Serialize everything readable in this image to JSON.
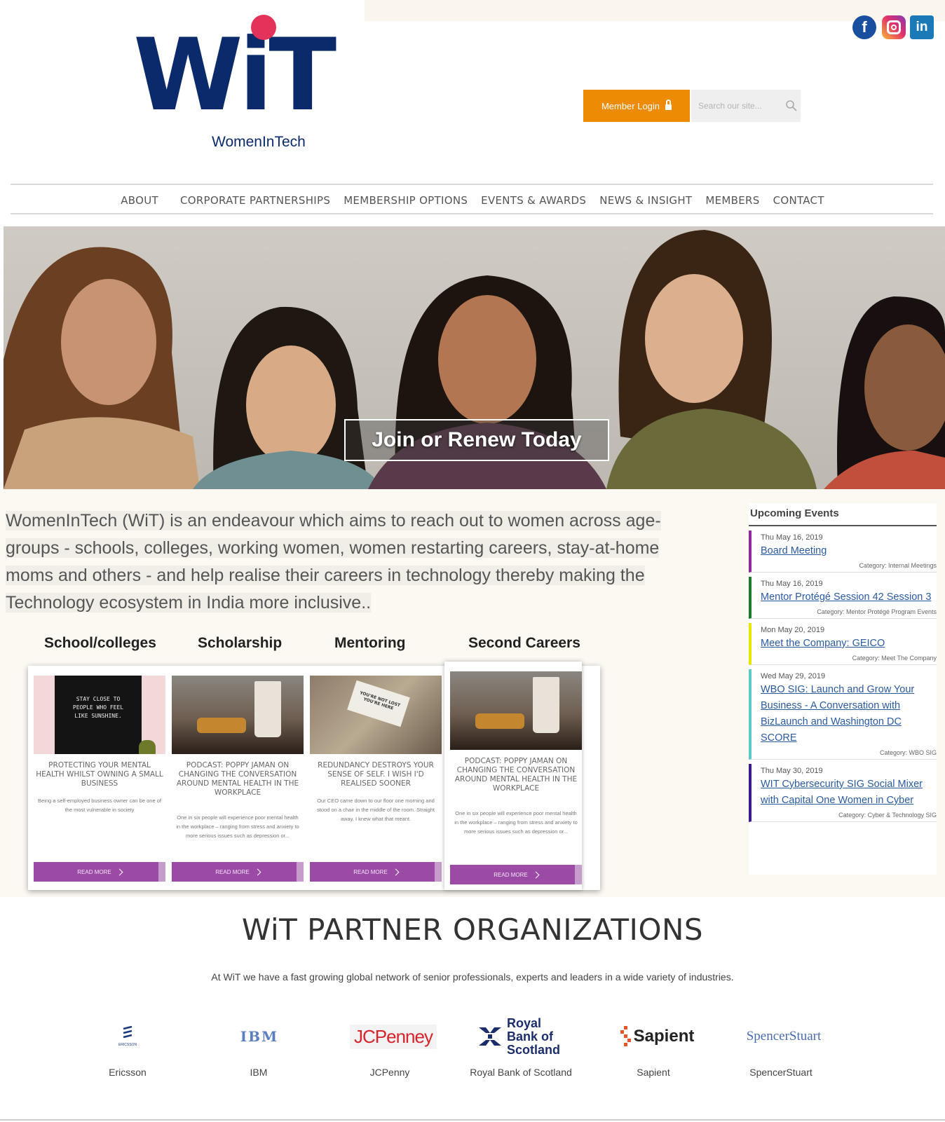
{
  "brand": {
    "logo_word": "WiT",
    "logo_sub": "WomenInTech",
    "colors": {
      "navy": "#0b2a6b",
      "accent_dot": "#e4335a",
      "orange": "#ee8b05",
      "purple": "#9b4aa6"
    }
  },
  "social": [
    {
      "name": "facebook-icon",
      "glyph": "f"
    },
    {
      "name": "instagram-icon",
      "glyph": ""
    },
    {
      "name": "linkedin-icon",
      "glyph": "in"
    }
  ],
  "header": {
    "login_label": "Member Login",
    "search_placeholder": "Search our site..."
  },
  "nav": [
    "ABOUT",
    "CORPORATE PARTNERSHIPS",
    "MEMBERSHIP OPTIONS",
    "EVENTS & AWARDS",
    "NEWS & INSIGHT",
    "MEMBERS",
    "CONTACT"
  ],
  "hero": {
    "cta": "Join or Renew Today"
  },
  "intro": "WomenInTech (WiT) is an endeavour which aims to reach out to women across age-groups - schools, colleges, working women, women restarting careers, stay-at-home moms and others - and help realise their careers in technology thereby making the Technology ecosystem in India more inclusive..",
  "categories": [
    "School/colleges",
    "Scholarship",
    "Mentoring",
    "Second Careers"
  ],
  "cards": [
    {
      "img_text": "STAY CLOSE TO PEOPLE WHO FEEL LIKE SUNSHINE.",
      "title": "PROTECTING YOUR MENTAL HEALTH WHILST OWNING A SMALL BUSINESS",
      "text": "Being a self-employed business owner can be one of the most vulnerable in society",
      "button": "READ MORE"
    },
    {
      "img_text": "",
      "title": "PODCAST: POPPY JAMAN ON CHANGING THE CONVERSATION AROUND MENTAL HEALTH IN THE WORKPLACE",
      "text": "One in six people will experience poor mental health in the workplace – ranging from stress and anxiety to more serious issues such as depression or...",
      "button": "READ MORE"
    },
    {
      "img_text": "YOU'RE NOT LOST YOU'RE HERE",
      "title": "REDUNDANCY DESTROYS YOUR SENSE OF SELF. I WISH I'D REALISED SOONER",
      "text": "Our CEO came down to our floor one morning and stood on a chair in the middle of the room. Straight away, I knew what that meant.",
      "button": "READ MORE"
    },
    {
      "img_text": "",
      "title": "PODCAST: POPPY JAMAN ON CHANGING THE CONVERSATION AROUND MENTAL HEALTH IN THE WORKPLACE",
      "text": "One in six people will experience poor mental health in the workplace – ranging from stress and anxiety to more serious issues such as depression or...",
      "button": "READ MORE"
    }
  ],
  "events": {
    "heading": "Upcoming Events",
    "items": [
      {
        "date": "Thu May 16, 2019",
        "title": "Board Meeting",
        "category": "Category: Internal Meetings",
        "color": "#8e2a9b"
      },
      {
        "date": "Thu May 16, 2019",
        "title": "Mentor Protégé Session 42 Session 3",
        "category": "Category: Mentor Protégé Program Events",
        "color": "#1d7a2a"
      },
      {
        "date": "Mon May 20, 2019",
        "title": "Meet the Company: GEICO",
        "category": "Category: Meet The Company",
        "color": "#e6e600"
      },
      {
        "date": "Wed May 29, 2019",
        "title": "WBO SIG: Launch and Grow Your Business - A Conversation with BizLaunch and Washington DC SCORE",
        "category": "Category: WBO SIG",
        "color": "#5cc8c8"
      },
      {
        "date": "Thu May 30, 2019",
        "title": "WIT Cybersecurity SIG Social Mixer with Capital One Women in Cyber",
        "category": "Category: Cyber & Technology SIG",
        "color": "#3b1a8c"
      }
    ]
  },
  "partners": {
    "title": "WiT PARTNER ORGANIZATIONS",
    "subtitle": "At WiT we have a fast growing global network of senior professionals, experts and leaders in a wide variety of industries.",
    "items": [
      {
        "name": "Ericsson",
        "logo": "ERICSSON"
      },
      {
        "name": "IBM",
        "logo": "IBM"
      },
      {
        "name": "JCPenny",
        "logo": "JCPenney"
      },
      {
        "name": "Royal Bank of Scotland",
        "logo": "Royal Bank of Scotland"
      },
      {
        "name": "Sapient",
        "logo": "Sapient"
      },
      {
        "name": "SpencerStuart",
        "logo": "SpencerStuart"
      }
    ]
  }
}
